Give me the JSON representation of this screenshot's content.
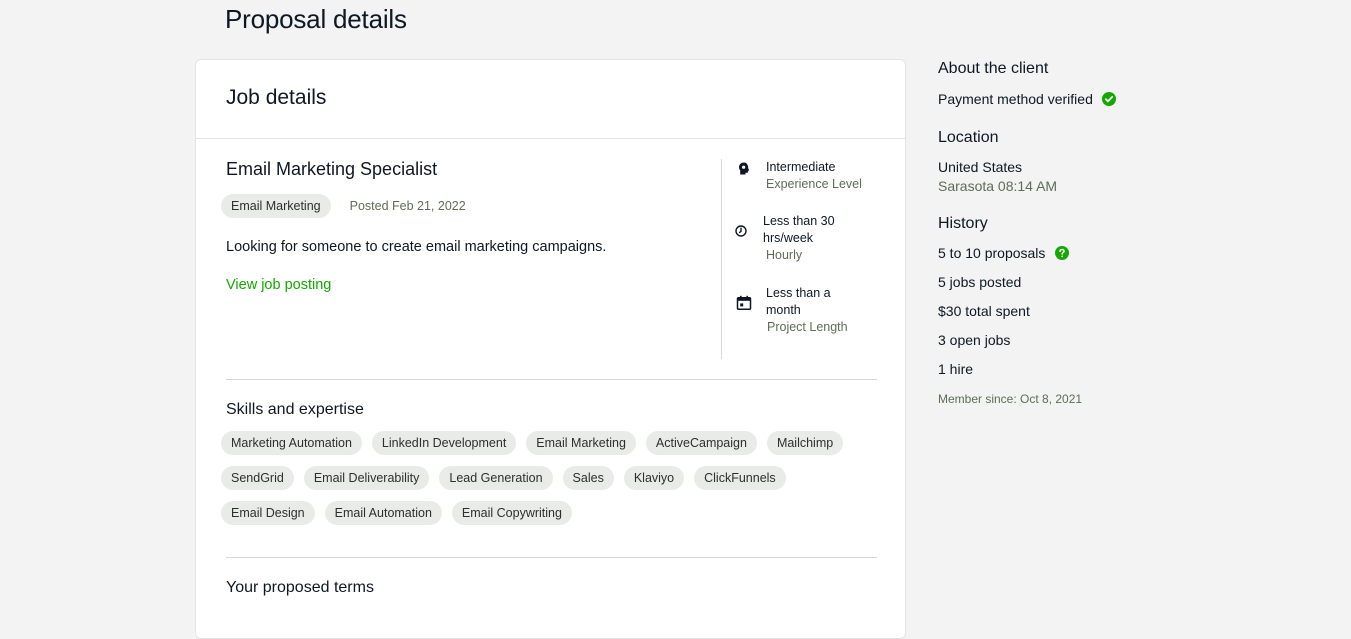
{
  "page": {
    "title": "Proposal details"
  },
  "job": {
    "section_title": "Job details",
    "title": "Email Marketing Specialist",
    "category_tag": "Email Marketing",
    "posted": "Posted Feb 21, 2022",
    "description": "Looking for someone to create email marketing campaigns.",
    "view_link": "View job posting",
    "features": [
      {
        "icon": "lightbulb-head-icon",
        "line1": "Intermediate",
        "line2": "Experience Level"
      },
      {
        "icon": "clock-icon",
        "line1": "Less than 30 hrs/week",
        "line2": "Hourly"
      },
      {
        "icon": "calendar-icon",
        "line1": "Less than a month",
        "line2": "Project Length"
      }
    ]
  },
  "skills": {
    "title": "Skills and expertise",
    "items": [
      "Marketing Automation",
      "LinkedIn Development",
      "Email Marketing",
      "ActiveCampaign",
      "Mailchimp",
      "SendGrid",
      "Email Deliverability",
      "Lead Generation",
      "Sales",
      "Klaviyo",
      "ClickFunnels",
      "Email Design",
      "Email Automation",
      "Email Copywriting"
    ]
  },
  "terms": {
    "title": "Your proposed terms"
  },
  "client": {
    "about_title": "About the client",
    "payment": "Payment method verified",
    "location_title": "Location",
    "country": "United States",
    "city_time": "Sarasota 08:14 AM",
    "history_title": "History",
    "proposals": "5 to 10 proposals",
    "jobs_posted": "5 jobs posted",
    "total_spent": "$30 total spent",
    "open_jobs": "3 open jobs",
    "hires": "1 hire",
    "member_since": "Member since: Oct 8, 2021"
  },
  "colors": {
    "accent_green": "#14a800",
    "verified_green": "#14a800",
    "background": "#f2f3f2",
    "card": "#ffffff"
  }
}
